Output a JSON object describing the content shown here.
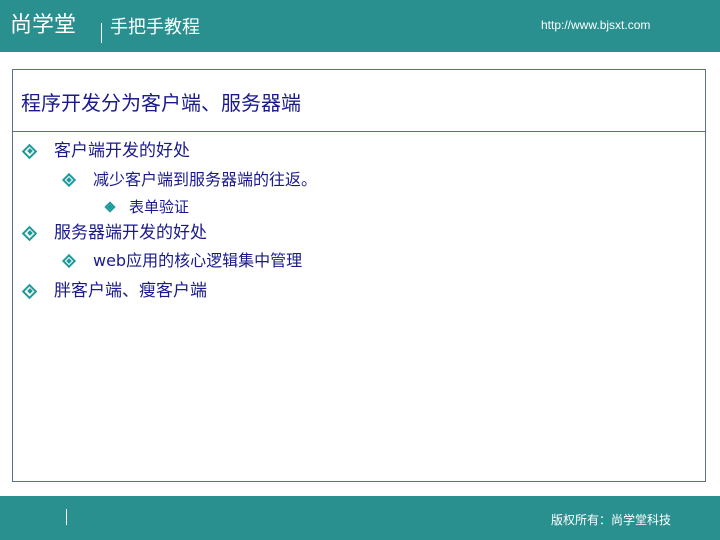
{
  "header": {
    "brand": "尚学堂",
    "tagline": "手把手教程",
    "url": "http://www.bjsxt.com"
  },
  "slide": {
    "title": "程序开发分为客户端、服务器端",
    "bullets": [
      {
        "level": 1,
        "text": "客户端开发的好处"
      },
      {
        "level": 2,
        "text": "减少客户端到服务器端的往返。"
      },
      {
        "level": 3,
        "text": "表单验证"
      },
      {
        "level": 1,
        "text": "服务器端开发的好处"
      },
      {
        "level": 2,
        "text": "web应用的核心逻辑集中管理"
      },
      {
        "level": 1,
        "text": "胖客户端、瘦客户端"
      }
    ]
  },
  "footer": {
    "copyright": "版权所有：尚学堂科技"
  },
  "colors": {
    "header_bg": "#2a8f8f",
    "text": "#1a1a8c",
    "bullet": "#1f9a9a",
    "frame": "#5a6e96"
  },
  "icons": {
    "bullet": "diamond-bullet-icon"
  }
}
